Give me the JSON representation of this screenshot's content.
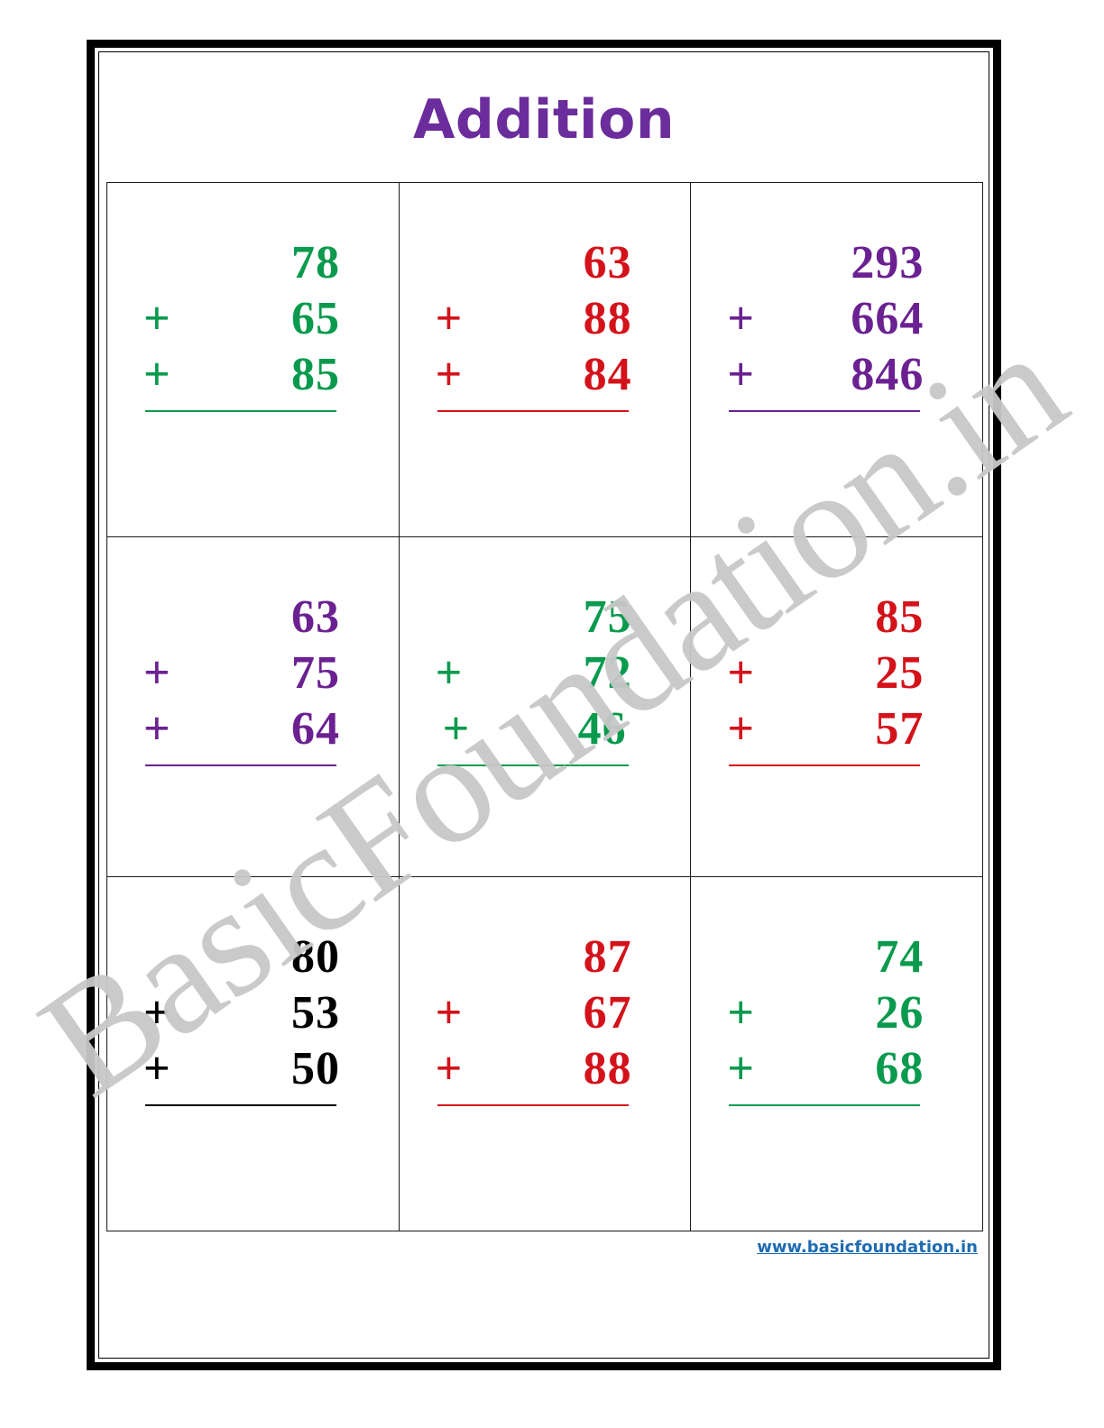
{
  "page": {
    "title": "Addition",
    "title_color": "#6B2D9B",
    "background_color": "#ffffff",
    "frame_color": "#000000"
  },
  "watermark": {
    "text": "BasicFoundation.in",
    "color": "#c8c8c8"
  },
  "colors": {
    "green": "#0A9A4E",
    "red": "#D4121A",
    "purple": "#6B2191",
    "black": "#000000",
    "link_blue": "#1f6bb0"
  },
  "worksheet": {
    "rows": 3,
    "columns": 3,
    "operator": "+",
    "problems": [
      {
        "index": 1,
        "color": "#0A9A4E",
        "color_name": "green",
        "addends": [
          "78",
          "65",
          "85"
        ],
        "op1": "+",
        "op2": "+"
      },
      {
        "index": 2,
        "color": "#D4121A",
        "color_name": "red",
        "addends": [
          "63",
          "88",
          "84"
        ],
        "op1": "+",
        "op2": "+"
      },
      {
        "index": 3,
        "color": "#6B2191",
        "color_name": "purple",
        "addends": [
          "293",
          "664",
          "846"
        ],
        "op1": "+",
        "op2": "+"
      },
      {
        "index": 4,
        "color": "#6B2191",
        "color_name": "purple",
        "addends": [
          "63",
          "75",
          "64"
        ],
        "op1": "+",
        "op2": "+"
      },
      {
        "index": 5,
        "color": "#0A9A4E",
        "color_name": "green",
        "addends": [
          "75",
          "72",
          "46"
        ],
        "op1": "+",
        "op2": "+"
      },
      {
        "index": 6,
        "color": "#D4121A",
        "color_name": "red",
        "addends": [
          "85",
          "25",
          "57"
        ],
        "op1": "+",
        "op2": "+"
      },
      {
        "index": 7,
        "color": "#000000",
        "color_name": "black",
        "addends": [
          "80",
          "53",
          "50"
        ],
        "op1": "+",
        "op2": "+"
      },
      {
        "index": 8,
        "color": "#D4121A",
        "color_name": "red",
        "addends": [
          "87",
          "67",
          "88"
        ],
        "op1": "+",
        "op2": "+"
      },
      {
        "index": 9,
        "color": "#0A9A4E",
        "color_name": "green",
        "addends": [
          "74",
          "26",
          "68"
        ],
        "op1": "+",
        "op2": "+"
      }
    ]
  },
  "footer": {
    "url_prefix": "www.",
    "url_domain": "basicfoundation.in",
    "url_full": "www.basicfoundation.in"
  }
}
